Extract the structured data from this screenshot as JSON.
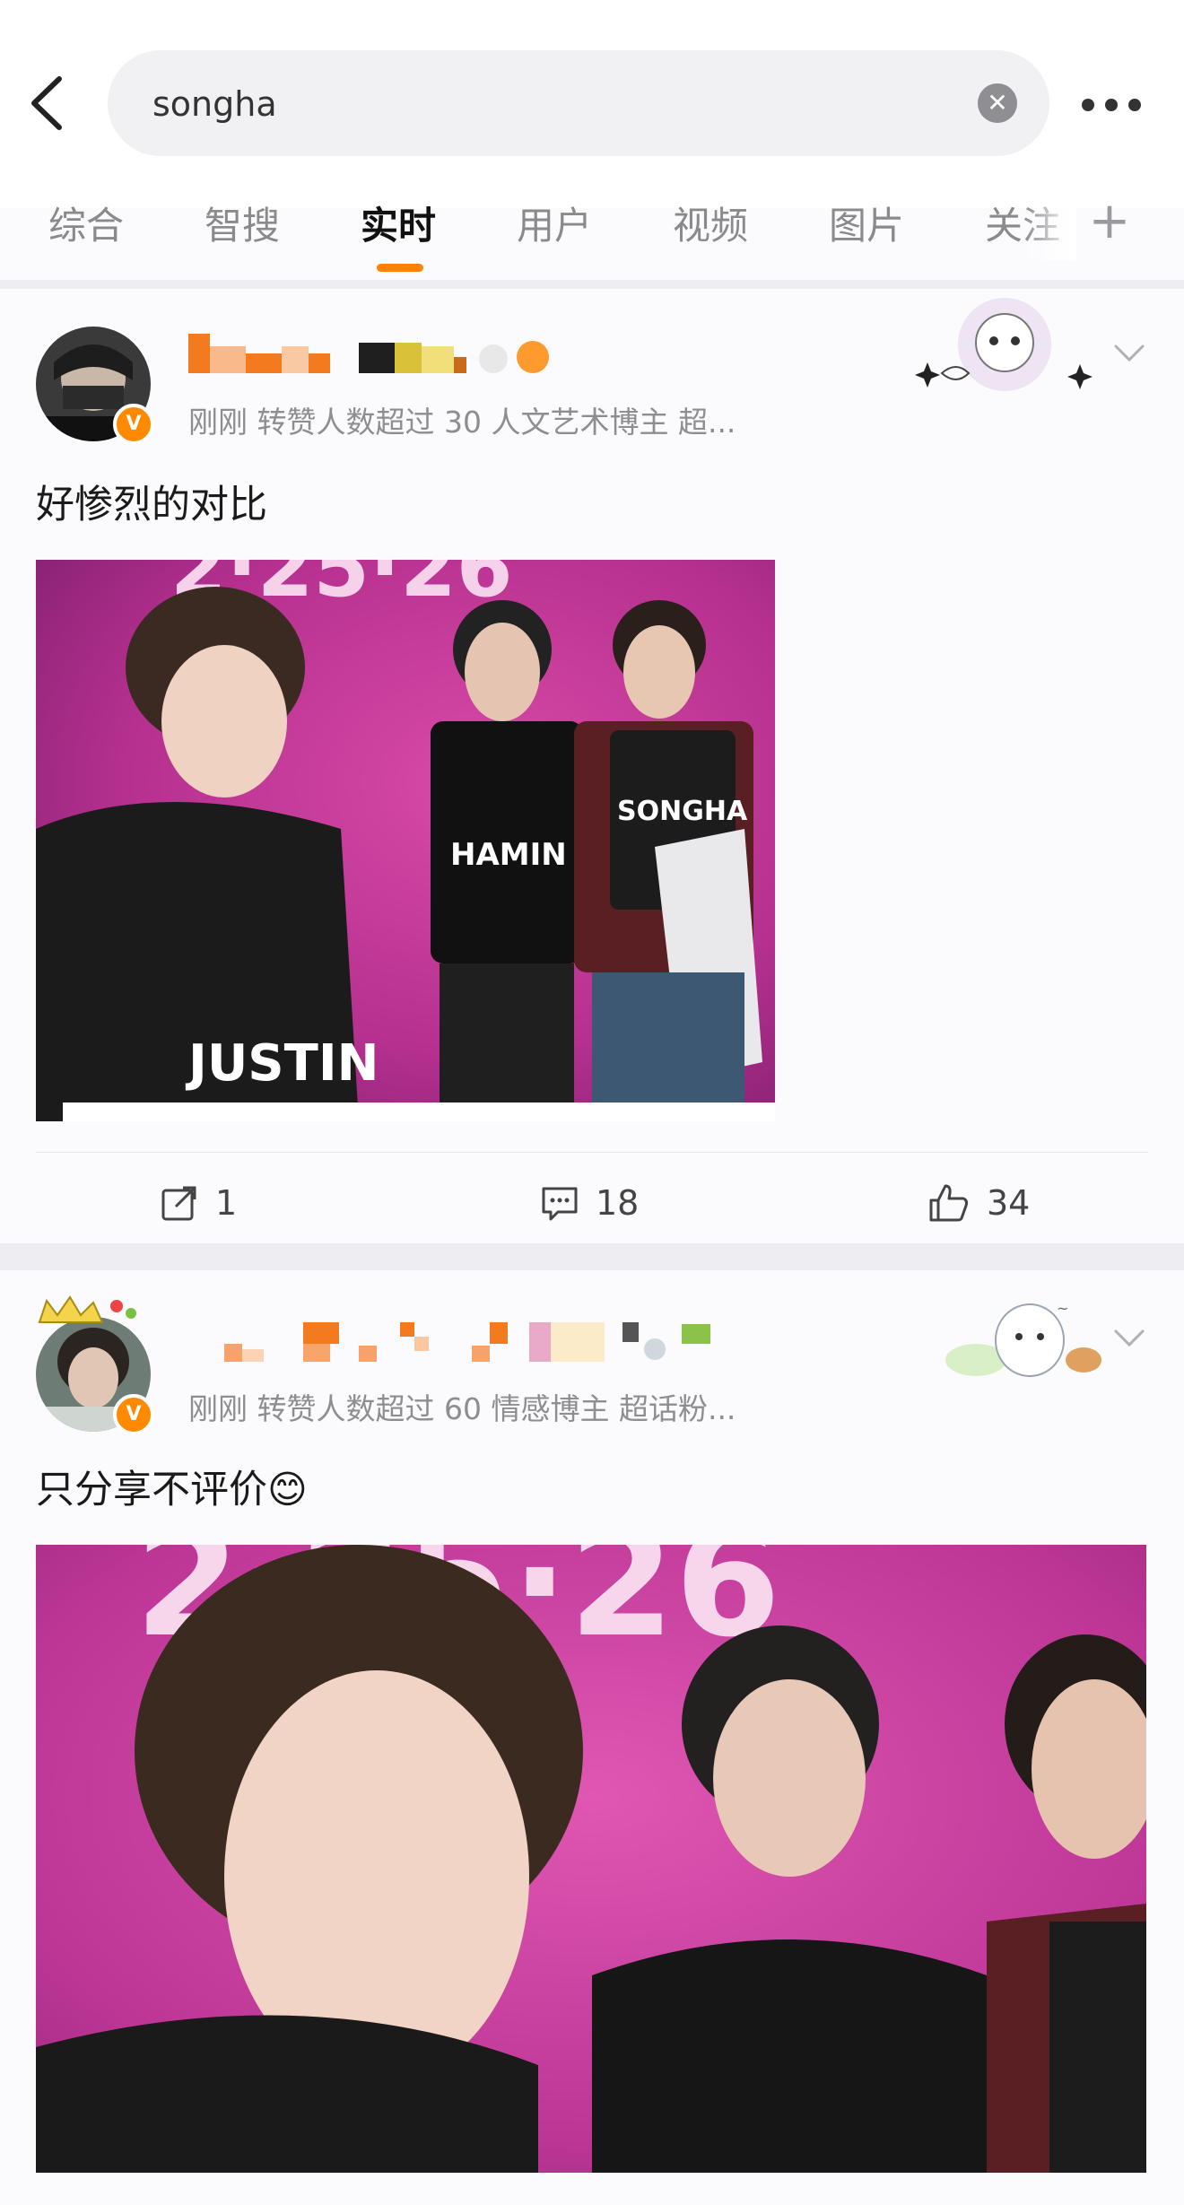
{
  "search": {
    "query": "songha"
  },
  "tabs": [
    {
      "label": "综合"
    },
    {
      "label": "智搜"
    },
    {
      "label": "实时"
    },
    {
      "label": "用户"
    },
    {
      "label": "视频"
    },
    {
      "label": "图片"
    },
    {
      "label": "关注"
    }
  ],
  "active_tab": "实时",
  "posts": [
    {
      "meta": "刚刚 转赞人数超过 30   人文艺术博主 超...",
      "text": "好惨烈的对比",
      "image_labels": [
        "JUSTIN",
        "HAMIN",
        "SONGHA"
      ],
      "reposts": "1",
      "comments": "18",
      "likes": "34"
    },
    {
      "meta": "刚刚 转赞人数超过 60   情感博主 超话粉...",
      "text": "只分享不评价",
      "emoji": "😊"
    }
  ],
  "colors": {
    "accent": "#ff8200",
    "badge": "#ff8a00"
  }
}
